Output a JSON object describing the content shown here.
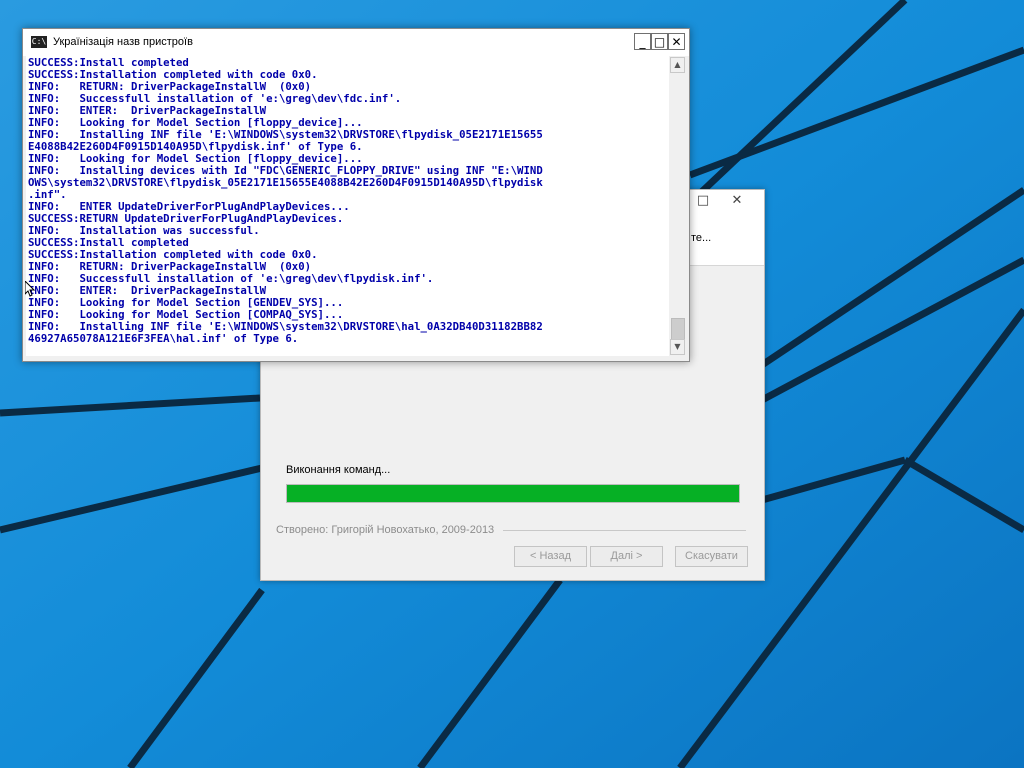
{
  "console": {
    "title": "Українізація назв пристроїв",
    "icon": "cmd-icon",
    "icon_text": "C:\\",
    "controls": {
      "minimize": "_",
      "maximize": "□",
      "close": "✕"
    },
    "lines": [
      "SUCCESS:Install completed",
      "SUCCESS:Installation completed with code 0x0.",
      "INFO:   RETURN: DriverPackageInstallW  (0x0)",
      "INFO:   Successfull installation of 'e:\\greg\\dev\\fdc.inf'.",
      "INFO:   ENTER:  DriverPackageInstallW",
      "INFO:   Looking for Model Section [floppy_device]...",
      "INFO:   Installing INF file 'E:\\WINDOWS\\system32\\DRVSTORE\\flpydisk_05E2171E15655",
      "E4088B42E260D4F0915D140A95D\\flpydisk.inf' of Type 6.",
      "INFO:   Looking for Model Section [floppy_device]...",
      "INFO:   Installing devices with Id \"FDC\\GENERIC_FLOPPY_DRIVE\" using INF \"E:\\WIND",
      "OWS\\system32\\DRVSTORE\\flpydisk_05E2171E15655E4088B42E260D4F0915D140A95D\\flpydisk",
      ".inf\".",
      "INFO:   ENTER UpdateDriverForPlugAndPlayDevices...",
      "SUCCESS:RETURN UpdateDriverForPlugAndPlayDevices.",
      "INFO:   Installation was successful.",
      "SUCCESS:Install completed",
      "SUCCESS:Installation completed with code 0x0.",
      "INFO:   RETURN: DriverPackageInstallW  (0x0)",
      "INFO:   Successfull installation of 'e:\\greg\\dev\\flpydisk.inf'.",
      "INFO:   ENTER:  DriverPackageInstallW",
      "INFO:   Looking for Model Section [GENDEV_SYS]...",
      "INFO:   Looking for Model Section [COMPAQ_SYS]...",
      "INFO:   Installing INF file 'E:\\WINDOWS\\system32\\DRVSTORE\\hal_0A32DB40D31182BB82",
      "46927A65078A121E6F3FEA\\hal.inf' of Type 6."
    ],
    "text_color": "#0000aa"
  },
  "wizard": {
    "header_text": "те...",
    "title_controls": {
      "maximize": "□",
      "close": "✕"
    },
    "status_text": "Виконання команд...",
    "progress": 1.0,
    "progress_color": "#06b025",
    "credits": "Створено: Григорій Новохатько, 2009-2013",
    "buttons": {
      "back": "< Назад",
      "next": "Далі >",
      "cancel": "Скасувати"
    }
  },
  "desktop": {
    "background": "#1a8fd6",
    "line_color": "#0a2a44"
  }
}
